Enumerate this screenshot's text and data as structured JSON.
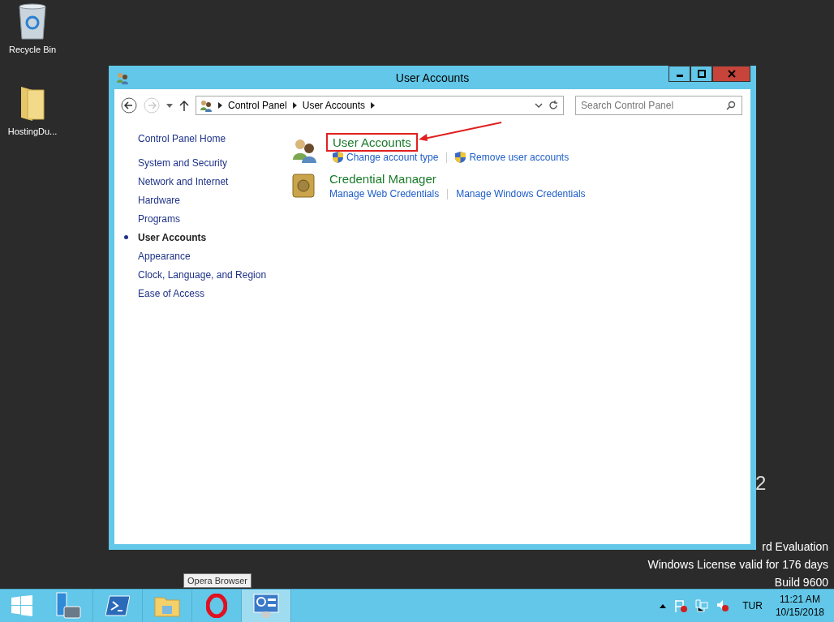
{
  "desktop_icons": [
    {
      "label": "Recycle Bin",
      "kind": "bin"
    },
    {
      "label": "HostingDu...",
      "kind": "folder"
    }
  ],
  "window": {
    "title": "User Accounts"
  },
  "address_bar": {
    "crumbs": [
      "Control Panel",
      "User Accounts"
    ]
  },
  "search": {
    "placeholder": "Search Control Panel"
  },
  "sidebar": {
    "home": "Control Panel Home",
    "items": [
      {
        "label": "System and Security",
        "selected": false
      },
      {
        "label": "Network and Internet",
        "selected": false
      },
      {
        "label": "Hardware",
        "selected": false
      },
      {
        "label": "Programs",
        "selected": false
      },
      {
        "label": "User Accounts",
        "selected": true
      },
      {
        "label": "Appearance",
        "selected": false
      },
      {
        "label": "Clock, Language, and Region",
        "selected": false
      },
      {
        "label": "Ease of Access",
        "selected": false
      }
    ]
  },
  "categories": [
    {
      "title": "User Accounts",
      "kind": "users",
      "highlighted": true,
      "links": [
        {
          "label": "Change account type",
          "shield": true
        },
        {
          "label": "Remove user accounts",
          "shield": true
        }
      ]
    },
    {
      "title": "Credential Manager",
      "kind": "vault",
      "highlighted": false,
      "links": [
        {
          "label": "Manage Web Credentials",
          "shield": false
        },
        {
          "label": "Manage Windows Credentials",
          "shield": false
        }
      ]
    }
  ],
  "desktop_watermark": {
    "edition_tail": "2",
    "edition": "rd Evaluation",
    "license": "Windows License valid for 176 days",
    "build": "Build 9600"
  },
  "tooltip": "Opera Browser",
  "taskbar": {
    "apps": [
      {
        "kind": "server",
        "selected": false
      },
      {
        "kind": "powershell",
        "selected": false
      },
      {
        "kind": "explorer",
        "selected": false
      },
      {
        "kind": "opera",
        "selected": false
      },
      {
        "kind": "control",
        "selected": true
      }
    ],
    "language": "TUR",
    "time": "11:21 AM",
    "date": "10/15/2018"
  }
}
